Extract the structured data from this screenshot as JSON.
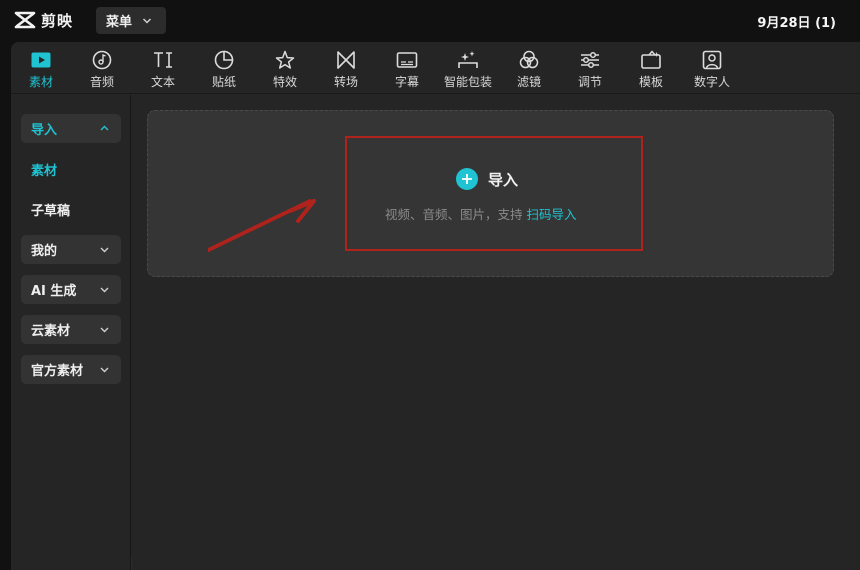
{
  "app": {
    "logo_text": "剪映",
    "menu_label": "菜单",
    "project_title": "9月28日 (1)"
  },
  "toolbar": {
    "tabs": [
      {
        "label": "素材",
        "icon": "media-play-icon",
        "active": true
      },
      {
        "label": "音频",
        "icon": "music-disc-icon",
        "active": false
      },
      {
        "label": "文本",
        "icon": "text-icon",
        "active": false
      },
      {
        "label": "贴纸",
        "icon": "sticker-icon",
        "active": false
      },
      {
        "label": "特效",
        "icon": "sparkle-star-icon",
        "active": false
      },
      {
        "label": "转场",
        "icon": "transition-bowtie-icon",
        "active": false
      },
      {
        "label": "字幕",
        "icon": "subtitle-keyboard-icon",
        "active": false
      },
      {
        "label": "智能包装",
        "icon": "smart-package-icon",
        "active": false
      },
      {
        "label": "滤镜",
        "icon": "filter-circles-icon",
        "active": false
      },
      {
        "label": "调节",
        "icon": "sliders-icon",
        "active": false
      },
      {
        "label": "模板",
        "icon": "template-icon",
        "active": false
      },
      {
        "label": "数字人",
        "icon": "digital-human-icon",
        "active": false
      }
    ]
  },
  "sidebar": {
    "items": [
      {
        "label": "导入",
        "type": "group",
        "expanded": true,
        "active": true
      },
      {
        "label": "素材",
        "type": "sub",
        "active": true
      },
      {
        "label": "子草稿",
        "type": "sub",
        "active": false
      },
      {
        "label": "我的",
        "type": "group",
        "expanded": false,
        "active": false
      },
      {
        "label": "AI 生成",
        "type": "group",
        "expanded": false,
        "active": false
      },
      {
        "label": "云素材",
        "type": "group",
        "expanded": false,
        "active": false
      },
      {
        "label": "官方素材",
        "type": "group",
        "expanded": false,
        "active": false
      }
    ]
  },
  "import_panel": {
    "title": "导入",
    "hint_prefix": "视频、音频、图片，支持 ",
    "hint_link": "扫码导入"
  },
  "colors": {
    "accent": "#1fc3d1",
    "highlight_box": "#b0231c",
    "arrow": "#b0231c",
    "panel_bg": "#252525",
    "dropzone_bg": "#353535"
  }
}
